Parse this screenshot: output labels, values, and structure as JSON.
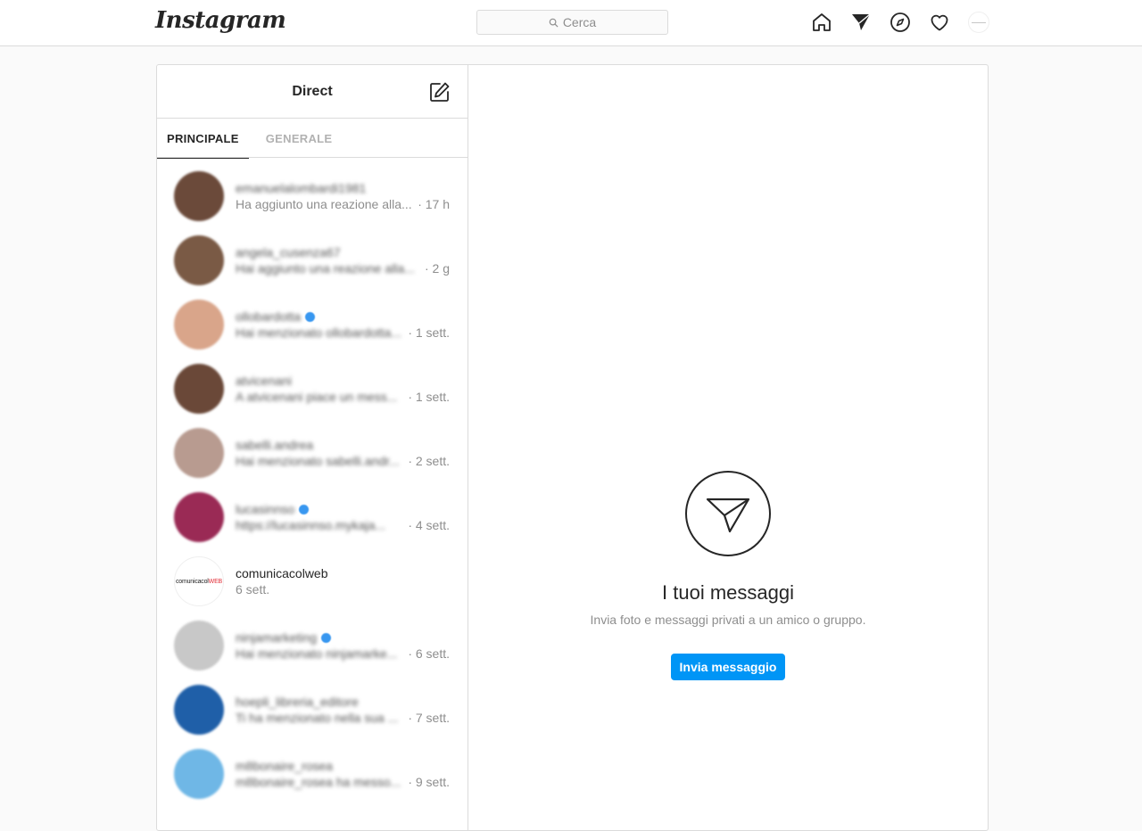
{
  "topbar": {
    "logo": "Instagram",
    "search_placeholder": "Cerca",
    "icons": [
      "home-icon",
      "direct-icon",
      "explore-icon",
      "activity-heart-icon",
      "profile-avatar"
    ]
  },
  "inbox": {
    "title": "Direct",
    "tabs": [
      {
        "label": "PRINCIPALE",
        "active": true
      },
      {
        "label": "GENERALE",
        "active": false
      }
    ],
    "threads": [
      {
        "name": "emanuelalombardi1981",
        "preview": "Ha aggiunto una reazione alla...",
        "time": "· 17 h",
        "blurred_name": true,
        "blurred_preview": false,
        "verified": false,
        "avatar_color": "#6b4a3a"
      },
      {
        "name": "angela_cusenza67",
        "preview": "Hai aggiunto una reazione alla...",
        "time": "· 2 g",
        "blurred_name": true,
        "blurred_preview": true,
        "verified": false,
        "avatar_color": "#7a5a45"
      },
      {
        "name": "ollobardotta",
        "preview": "Hai menzionato ollobardotta...",
        "time": "· 1 sett.",
        "blurred_name": true,
        "blurred_preview": true,
        "verified": true,
        "avatar_color": "#d9a58a"
      },
      {
        "name": "atvicenani",
        "preview": "A atvicenani piace un mess...",
        "time": "· 1 sett.",
        "blurred_name": true,
        "blurred_preview": true,
        "verified": false,
        "avatar_color": "#6a4838"
      },
      {
        "name": "sabelli.andrea",
        "preview": "Hai menzionato sabelli.andr...",
        "time": "· 2 sett.",
        "blurred_name": true,
        "blurred_preview": true,
        "verified": false,
        "avatar_color": "#b89b90"
      },
      {
        "name": "lucasinnso",
        "preview": "https://lucasinnso.mykaja...",
        "time": "· 4 sett.",
        "blurred_name": true,
        "blurred_preview": true,
        "verified": true,
        "avatar_color": "#9a2a55"
      },
      {
        "name": "comunicacolweb",
        "preview": "6 sett.",
        "time": "",
        "blurred_name": false,
        "blurred_preview": false,
        "verified": false,
        "avatar_color": "#ffffff",
        "avatar_text": "comunicacolWEB"
      },
      {
        "name": "ninjamarketing",
        "preview": "Hai menzionato ninjamarke...",
        "time": "· 6 sett.",
        "blurred_name": true,
        "blurred_preview": true,
        "verified": true,
        "avatar_color": "#c8c8c8"
      },
      {
        "name": "hoepli_libreria_editore",
        "preview": "Ti ha menzionato nella sua ...",
        "time": "· 7 sett.",
        "blurred_name": true,
        "blurred_preview": true,
        "verified": false,
        "avatar_color": "#1f5fa8"
      },
      {
        "name": "m8bonaire_rosea",
        "preview": "m8bonaire_rosea ha messo...",
        "time": "· 9 sett.",
        "blurred_name": true,
        "blurred_preview": true,
        "verified": false,
        "avatar_color": "#6fb7e6"
      }
    ]
  },
  "empty_state": {
    "icon": "paper-plane-icon",
    "title": "I tuoi messaggi",
    "subtitle": "Invia foto e messaggi privati a un amico o gruppo.",
    "button_label": "Invia messaggio"
  },
  "colors": {
    "accent": "#0095f6",
    "border": "#dbdbdb",
    "background": "#fafafa",
    "verified": "#3897f0"
  }
}
